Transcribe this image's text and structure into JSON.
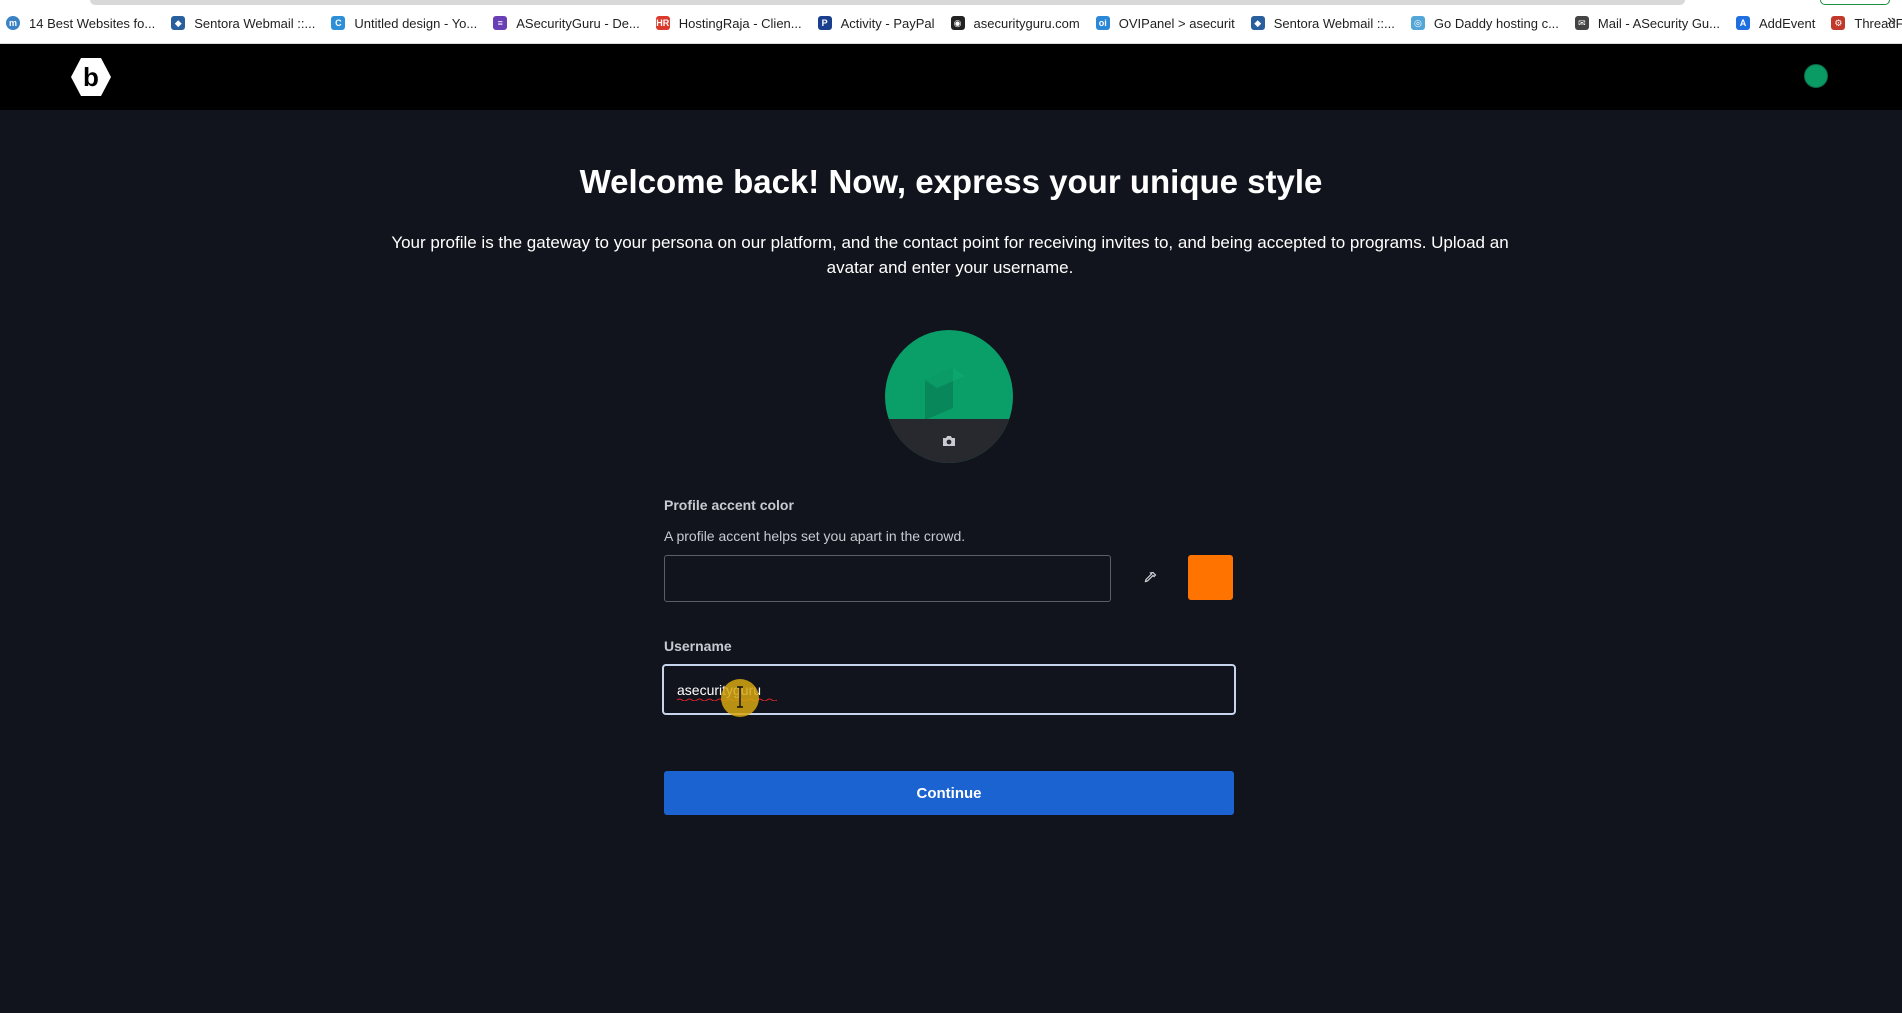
{
  "bookmarks": [
    {
      "label": "14 Best Websites fo...",
      "icon": "m-circle-icon",
      "color": "#3b82c4"
    },
    {
      "label": "Sentora Webmail ::...",
      "icon": "globe-icon",
      "color": "#2a5f9e"
    },
    {
      "label": "Untitled design - Yo...",
      "icon": "canva-icon",
      "color": "#2d8fd5"
    },
    {
      "label": "ASecurityGuru - De...",
      "icon": "list-icon",
      "color": "#6a3fb5"
    },
    {
      "label": "HostingRaja - Clien...",
      "icon": "hr-icon",
      "color": "#d93a2b"
    },
    {
      "label": "Activity - PayPal",
      "icon": "paypal-icon",
      "color": "#1b3f8f"
    },
    {
      "label": "asecurityguru.com",
      "icon": "world-icon",
      "color": "#222222"
    },
    {
      "label": "OVIPanel > asecurit",
      "icon": "ovi-icon",
      "color": "#2b87d8"
    },
    {
      "label": "Sentora Webmail ::...",
      "icon": "globe-icon",
      "color": "#2a5f9e"
    },
    {
      "label": "Go Daddy hosting c...",
      "icon": "spiral-icon",
      "color": "#53a7d8"
    },
    {
      "label": "Mail - ASecurity Gu...",
      "icon": "mail-icon",
      "color": "#444444"
    },
    {
      "label": "AddEvent",
      "icon": "addevent-icon",
      "color": "#1f6fe0"
    },
    {
      "label": "ThreadFix - Coalfire",
      "icon": "threadfix-icon",
      "color": "#c0392b"
    }
  ],
  "bookmarks_more": "»",
  "header": {
    "logo_letter": "b"
  },
  "title": "Welcome back! Now, express your unique style",
  "description": "Your profile is the gateway to your persona on our platform, and the contact point for receiving invites to, and being accepted to programs. Upload an avatar and enter your username.",
  "accent": {
    "label": "Profile accent color",
    "hint": "A profile accent helps set you apart in the crowd.",
    "value": "",
    "swatch_color": "#ff7300"
  },
  "username": {
    "label": "Username",
    "value": "asecurityguru"
  },
  "continue_label": "Continue",
  "colors": {
    "page_bg": "#11141c",
    "header_bg": "#000000",
    "avatar_green": "#0a9e68",
    "primary_button": "#1b63d1",
    "focus_border": "#c6d4ec"
  }
}
